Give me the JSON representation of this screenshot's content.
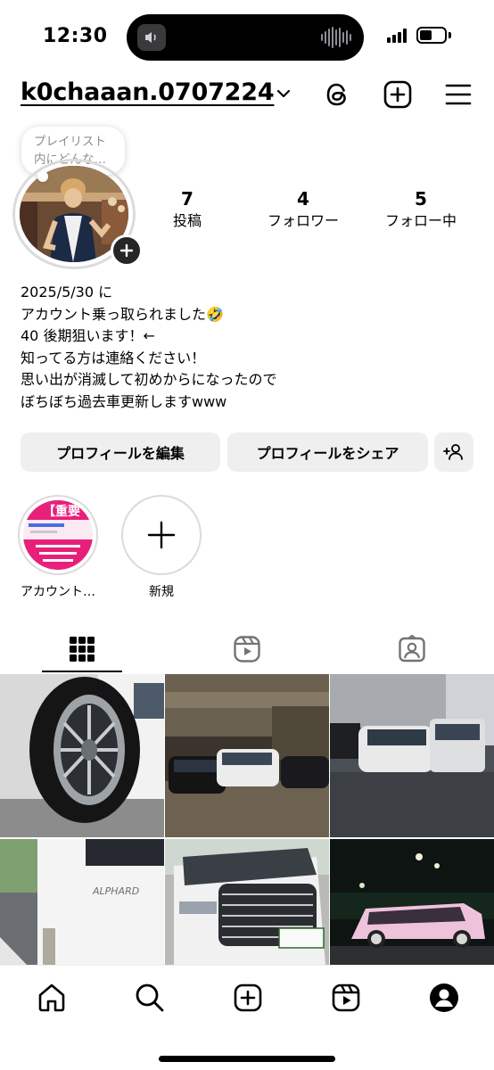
{
  "status_bar": {
    "time": "12:30"
  },
  "header": {
    "username": "k0chaaan.0707224"
  },
  "note": {
    "text": "プレイリスト内にどんな…"
  },
  "stats": [
    {
      "value": "7",
      "label": "投稿"
    },
    {
      "value": "4",
      "label": "フォロワー"
    },
    {
      "value": "5",
      "label": "フォロー中"
    }
  ],
  "bio": [
    "2025/5/30 に",
    "アカウント乗っ取られました🤣",
    "40 後期狙います！←",
    "知ってる方は連絡ください！",
    "思い出が消滅して初めからになったので",
    "ぼちぼち過去車更新しますwww"
  ],
  "buttons": {
    "edit_profile": "プロフィールを編集",
    "share_profile": "プロフィールをシェア"
  },
  "highlights": [
    {
      "label": "アカウント…",
      "thumb_text": "【重要"
    },
    {
      "label": "新規"
    }
  ],
  "colors": {
    "button_bg": "#efefef",
    "ring": "#dbdbdb",
    "highlight_pink": "#e8207a"
  }
}
